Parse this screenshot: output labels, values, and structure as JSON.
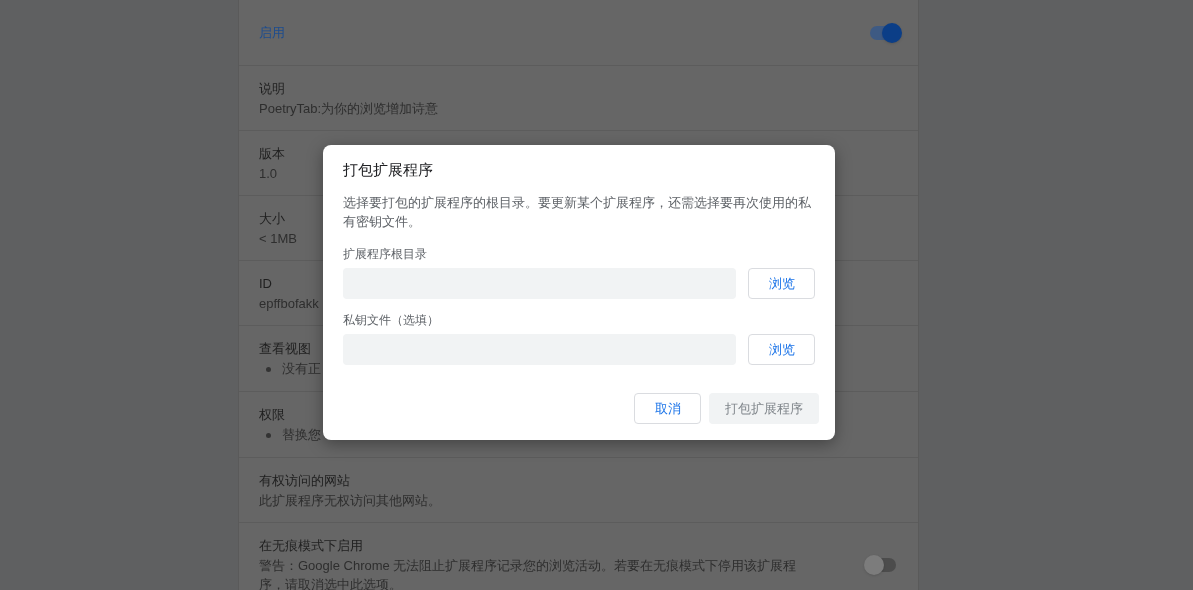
{
  "details": {
    "rows": [
      {
        "kind": "toggle",
        "label": "启用",
        "on": true
      },
      {
        "kind": "text",
        "label": "说明",
        "value": "PoetryTab:为你的浏览增加诗意"
      },
      {
        "kind": "text",
        "label": "版本",
        "value": "1.0"
      },
      {
        "kind": "text",
        "label": "大小",
        "value": "< 1MB"
      },
      {
        "kind": "text",
        "label": "ID",
        "value": "epffbofakk"
      },
      {
        "kind": "list",
        "label": "查看视图",
        "items": [
          "没有正"
        ]
      },
      {
        "kind": "list",
        "label": "权限",
        "items": [
          "替换您"
        ]
      },
      {
        "kind": "text",
        "label": "有权访问的网站",
        "value": "此扩展程序无权访问其他网站。"
      },
      {
        "kind": "toggle_text",
        "label": "在无痕模式下启用",
        "value": "警告：Google Chrome 无法阻止扩展程序记录您的浏览活动。若要在无痕模式下停用该扩展程序，请取消选中此选项。",
        "on": false
      }
    ]
  },
  "dialog": {
    "title": "打包扩展程序",
    "description": "选择要打包的扩展程序的根目录。要更新某个扩展程序，还需选择要再次使用的私有密钥文件。",
    "fields": [
      {
        "label": "扩展程序根目录",
        "button": "浏览"
      },
      {
        "label": "私钥文件（选填）",
        "button": "浏览"
      }
    ],
    "buttons": [
      {
        "label": "取消",
        "disabled": false
      },
      {
        "label": "打包扩展程序",
        "disabled": true
      }
    ]
  }
}
